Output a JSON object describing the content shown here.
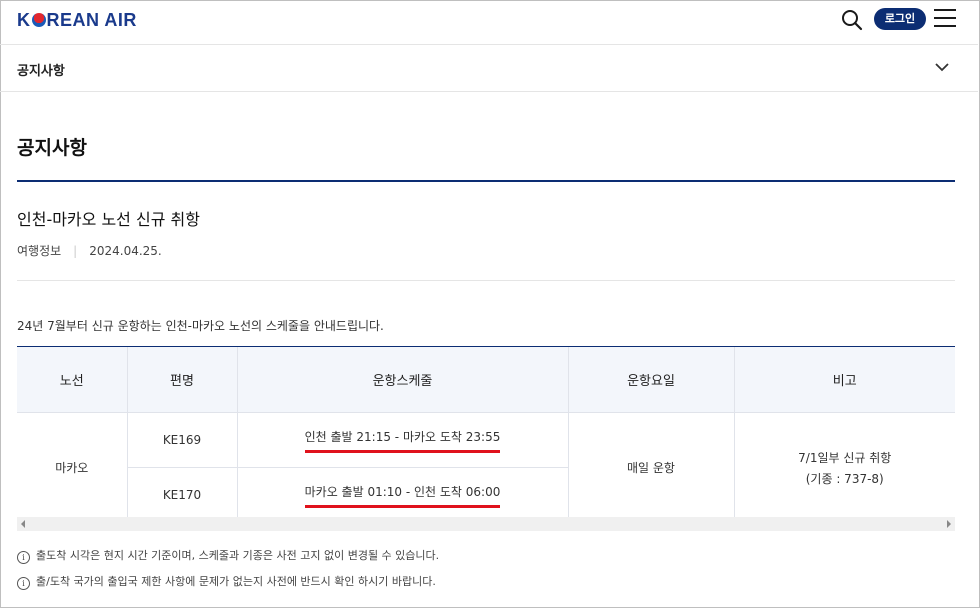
{
  "header": {
    "logo_text": "KOREAN AIR",
    "login_label": "로그인"
  },
  "nav": {
    "title": "공지사항"
  },
  "page": {
    "title": "공지사항"
  },
  "notice": {
    "title": "인천-마카오 노선 신규 취항",
    "category": "여행정보",
    "date": "2024.04.25.",
    "intro": "24년 7월부터 신규 운항하는 인천-마카오 노선의 스케줄을 안내드립니다."
  },
  "table": {
    "headers": [
      "노선",
      "편명",
      "운항스케줄",
      "운항요일",
      "비고"
    ],
    "route": "마카오",
    "rows": [
      {
        "flight": "KE169",
        "schedule": "인천 출발 21:15 - 마카오 도착 23:55"
      },
      {
        "flight": "KE170",
        "schedule": "마카오 출발 01:10 - 인천 도착 06:00"
      }
    ],
    "days": "매일 운항",
    "remarks_line1": "7/1일부 신규 취항",
    "remarks_line2": "(기종 : 737-8)"
  },
  "notes": [
    "출도착 시각은 현지 시간 기준이며, 스케줄과 기종은 사전 고지 없이 변경될 수 있습니다.",
    "출/도착 국가의 출입국 제한 사항에 문제가 없는지 사전에 반드시 확인 하시기 바랍니다."
  ],
  "icons": {
    "search": "search-icon",
    "menu": "menu-icon",
    "chevron": "chevron-down-icon",
    "info": "info-icon"
  },
  "colors": {
    "brand_navy": "#0c2d73",
    "highlight_red": "#e0121c"
  }
}
